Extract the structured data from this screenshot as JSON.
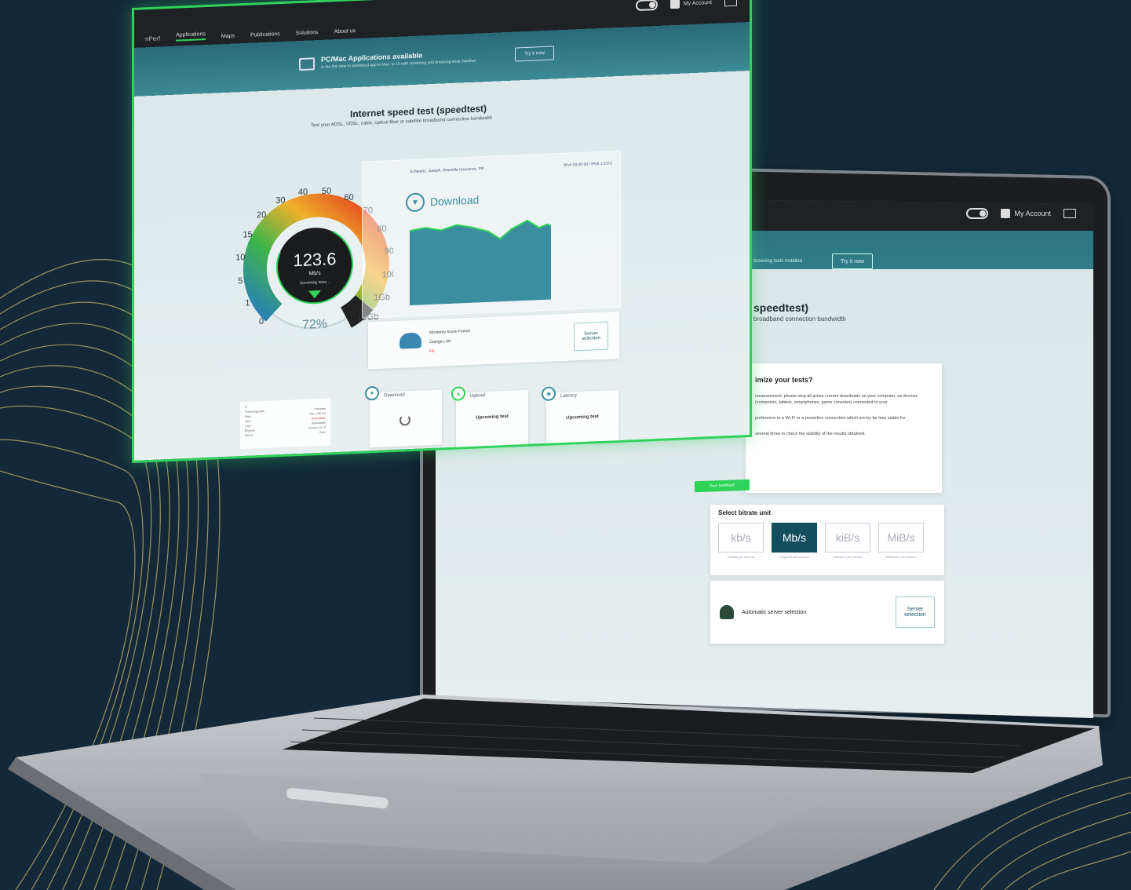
{
  "colors": {
    "background": "#13293a",
    "accent_green": "#2fd35a",
    "teal": "#2a6a78",
    "unit_active": "#134e5e"
  },
  "floating_window": {
    "header": {
      "logo": "nPerf",
      "nav": [
        "Applications",
        "Maps",
        "Publications",
        "Solutions",
        "About us"
      ],
      "active_nav": "Applications",
      "account_label": "My Account"
    },
    "banner": {
      "title": "PC/Mac Applications available",
      "text": "Is the first time to download app to Mac, to 10 with screening and browsing tools installed",
      "button": "Try it now"
    },
    "title": "Internet speed test (speedtest)",
    "subtitle": "Test your ADSL, VDSL, cable, optical fiber or satellite broadband connection bandwidth",
    "gauge": {
      "value": "123.6",
      "unit": "Mb/s",
      "status": "Upcoming tests...",
      "percent": "72%",
      "ticks": [
        "0",
        "1",
        "5",
        "10",
        "15",
        "20",
        "30",
        "40",
        "50",
        "60",
        "70",
        "80",
        "90",
        "100",
        "1Gb",
        "10Gb"
      ],
      "progress": 0.72
    },
    "download_panel": {
      "header_left": "Schwartz, Joseph, Rouselle Insurance, FR",
      "header_right": "IPv4 00:00:00 / IPv6 1.0.0.0",
      "label": "Download"
    },
    "server": {
      "name": "Monterey Azure France",
      "isp": "Orange LAN",
      "flag": "FR",
      "button": "Server selection"
    },
    "info_table": [
      {
        "k": "IP",
        "v": ""
      },
      {
        "k": "Technology type",
        "v": "Unknown"
      },
      {
        "k": "Ping",
        "v": "100 - 100 Km"
      },
      {
        "k": "Jitter",
        "v": "Unavailable",
        "red": true
      },
      {
        "k": "Loss",
        "v": "Unavailable"
      },
      {
        "k": "Browser",
        "v": "Chrome 127.0"
      },
      {
        "k": "Server",
        "v": "Paris"
      }
    ],
    "tests": [
      {
        "label": "Download",
        "body": "",
        "spinner": true
      },
      {
        "label": "Upload",
        "body": "Upcoming test",
        "spinner": false
      },
      {
        "label": "Latency",
        "body": "Upcoming test",
        "spinner": false
      }
    ],
    "feedback_tab": "Give feedback"
  },
  "laptop_screen": {
    "account_label": "My Account",
    "banner_text": "browsing tools installed",
    "banner_button": "Try it now",
    "title": "speedtest)",
    "subtitle": "broadband connection bandwidth",
    "tips": {
      "title": "imize your tests?",
      "items": [
        "measurement, please stop all active current downloads on your computer, as devices (computers, tablets, smartphones, game consoles) connected to your",
        "preference to a Wi-Fi or a powerline connection which are by far less stable for",
        "several times to check the stability of the results obtained."
      ]
    },
    "bitrate": {
      "title": "Select bitrate unit",
      "options": [
        {
          "label": "kb/s",
          "caption": "Kilobits per second",
          "active": false
        },
        {
          "label": "Mb/s",
          "caption": "Megabits per second",
          "active": true
        },
        {
          "label": "kiB/s",
          "caption": "Kibibytes per second",
          "active": false
        },
        {
          "label": "MiB/s",
          "caption": "Mebibytes per second",
          "active": false
        }
      ]
    },
    "server": {
      "text": "Automatic server selection",
      "button": "Server selection"
    }
  }
}
